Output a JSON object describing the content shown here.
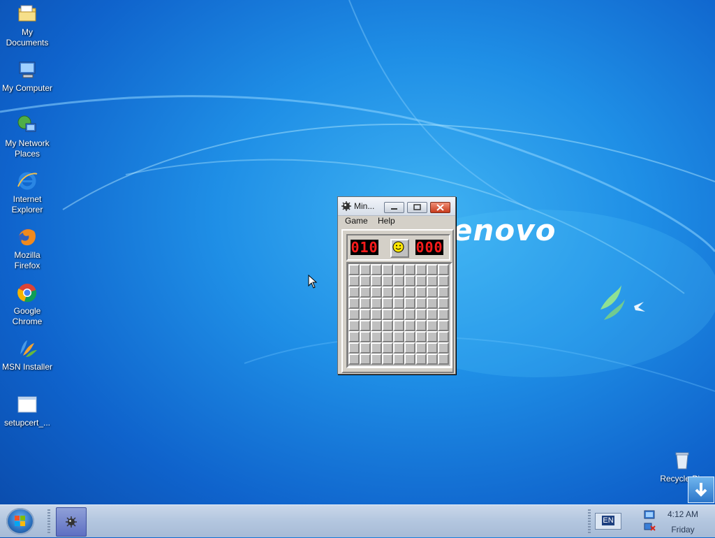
{
  "desktop": {
    "icons": [
      {
        "label_line1": "My",
        "label_line2": "Documents",
        "icon": "my-documents-icon"
      },
      {
        "label_line1": "My Computer",
        "label_line2": "",
        "icon": "my-computer-icon"
      },
      {
        "label_line1": "My Network",
        "label_line2": "Places",
        "icon": "network-places-icon"
      },
      {
        "label_line1": "Internet",
        "label_line2": "Explorer",
        "icon": "internet-explorer-icon"
      },
      {
        "label_line1": "Mozilla",
        "label_line2": "Firefox",
        "icon": "firefox-icon"
      },
      {
        "label_line1": "Google",
        "label_line2": "Chrome",
        "icon": "chrome-icon"
      },
      {
        "label_line1": "MSN Installer",
        "label_line2": "",
        "icon": "msn-installer-icon"
      },
      {
        "label_line1": "setupcert_...",
        "label_line2": "",
        "icon": "window-file-icon"
      }
    ],
    "recycle_bin": "Recycle Bin",
    "wallpaper_brand": "enovo"
  },
  "minesweeper": {
    "title": "Min...",
    "menu": [
      "Game",
      "Help"
    ],
    "mine_counter": "010",
    "timer": "000",
    "face": "smiley-icon",
    "rows": 9,
    "cols": 9
  },
  "taskbar": {
    "language": "EN",
    "time": "4:12 AM",
    "day": "Friday"
  },
  "colors": {
    "desktop_blue": "#1f8fe6",
    "lcd_red": "#ff1b1b",
    "window_gray": "#d4d0c8"
  }
}
